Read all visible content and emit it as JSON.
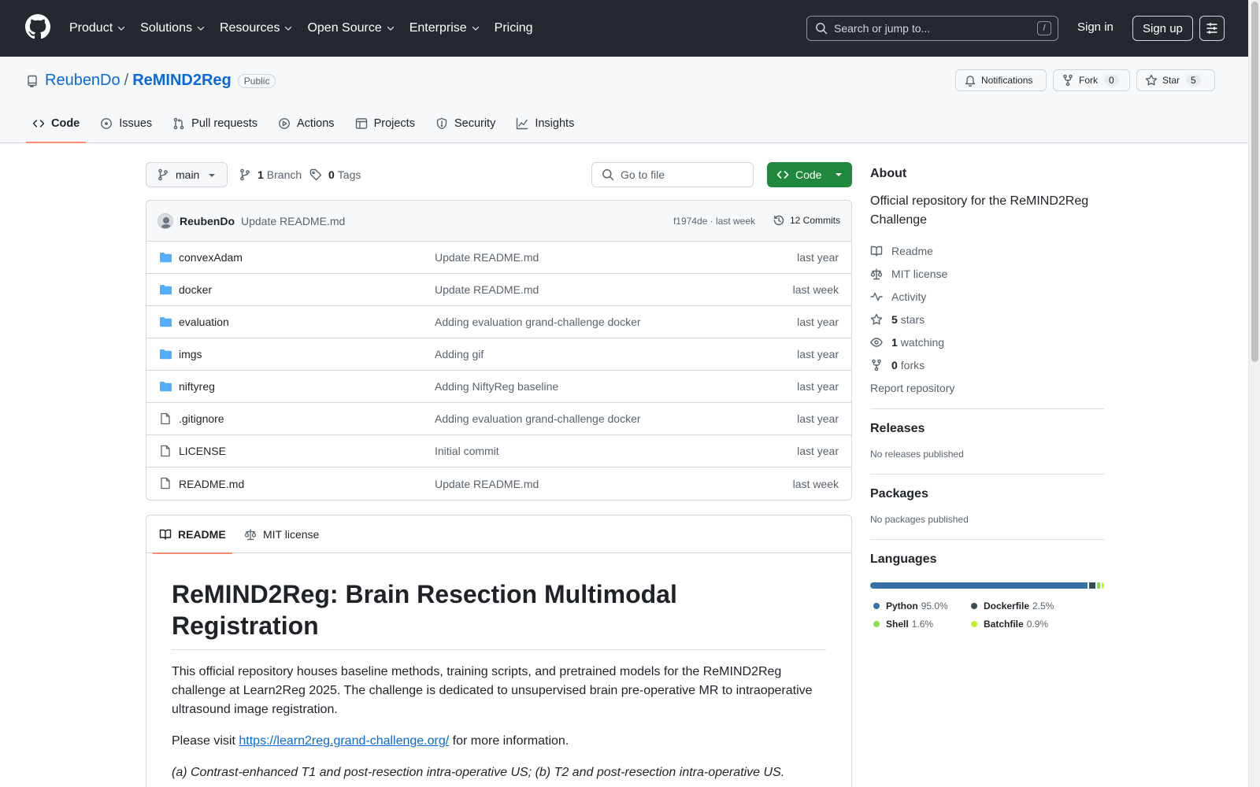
{
  "topnav": {
    "items": [
      {
        "label": "Product",
        "dropdown": true
      },
      {
        "label": "Solutions",
        "dropdown": true
      },
      {
        "label": "Resources",
        "dropdown": true
      },
      {
        "label": "Open Source",
        "dropdown": true
      },
      {
        "label": "Enterprise",
        "dropdown": true
      },
      {
        "label": "Pricing",
        "dropdown": false
      }
    ],
    "search_placeholder": "Search or jump to...",
    "search_shortcut": "/",
    "signin": "Sign in",
    "signup": "Sign up"
  },
  "repo": {
    "owner": "ReubenDo",
    "separator": "/",
    "name": "ReMIND2Reg",
    "visibility": "Public",
    "notifications_label": "Notifications",
    "fork_label": "Fork",
    "fork_count": "0",
    "star_label": "Star",
    "star_count": "5"
  },
  "tabs": [
    {
      "label": "Code",
      "icon": "code-icon",
      "active": true
    },
    {
      "label": "Issues",
      "icon": "issue-icon",
      "active": false
    },
    {
      "label": "Pull requests",
      "icon": "pull-request-icon",
      "active": false
    },
    {
      "label": "Actions",
      "icon": "play-icon",
      "active": false
    },
    {
      "label": "Projects",
      "icon": "table-icon",
      "active": false
    },
    {
      "label": "Security",
      "icon": "shield-icon",
      "active": false
    },
    {
      "label": "Insights",
      "icon": "graph-icon",
      "active": false
    }
  ],
  "toolbar": {
    "branch": "main",
    "branch_count": "1",
    "branch_label": "Branch",
    "tag_count": "0",
    "tag_label": "Tags",
    "gofile_placeholder": "Go to file",
    "code_label": "Code"
  },
  "commit": {
    "author": "ReubenDo",
    "message": "Update README.md",
    "meta": "f1974de · last week",
    "commits_label": "12 Commits"
  },
  "files": [
    {
      "name": "convexAdam",
      "type": "folder",
      "message": "Update README.md",
      "date": "last year"
    },
    {
      "name": "docker",
      "type": "folder",
      "message": "Update README.md",
      "date": "last week"
    },
    {
      "name": "evaluation",
      "type": "folder",
      "message": "Adding evaluation grand-challenge docker",
      "date": "last year"
    },
    {
      "name": "imgs",
      "type": "folder",
      "message": "Adding gif",
      "date": "last year"
    },
    {
      "name": "niftyreg",
      "type": "folder",
      "message": "Adding NiftyReg baseline",
      "date": "last year"
    },
    {
      "name": ".gitignore",
      "type": "file",
      "message": "Adding evaluation grand-challenge docker",
      "date": "last year"
    },
    {
      "name": "LICENSE",
      "type": "file",
      "message": "Initial commit",
      "date": "last year"
    },
    {
      "name": "README.md",
      "type": "file",
      "message": "Update README.md",
      "date": "last week"
    }
  ],
  "readme": {
    "tab_readme": "README",
    "tab_license": "MIT license",
    "title": "ReMIND2Reg: Brain Resection Multimodal Registration",
    "paragraph1": "This official repository houses baseline methods, training scripts, and pretrained models for the ReMIND2Reg challenge at Learn2Reg 2025. The challenge is dedicated to unsupervised brain pre-operative MR to intraoperative ultrasound image registration.",
    "visit_prefix": "Please visit ",
    "visit_link": "https://learn2reg.grand-challenge.org/",
    "visit_suffix": " for more information.",
    "caption": "(a) Contrast-enhanced T1 and post-resection intra-operative US; (b) T2 and post-resection intra-operative US."
  },
  "about": {
    "heading": "About",
    "description": "Official repository for the ReMIND2Reg Challenge",
    "links": [
      {
        "icon": "book-icon",
        "count": "",
        "label": "Readme"
      },
      {
        "icon": "law-icon",
        "count": "",
        "label": "MIT license"
      },
      {
        "icon": "pulse-icon",
        "count": "",
        "label": "Activity"
      },
      {
        "icon": "star-icon",
        "count": "5",
        "label": "stars"
      },
      {
        "icon": "eye-icon",
        "count": "1",
        "label": "watching"
      },
      {
        "icon": "fork-icon",
        "count": "0",
        "label": "forks"
      }
    ],
    "report": "Report repository"
  },
  "releases": {
    "heading": "Releases",
    "text": "No releases published"
  },
  "packages": {
    "heading": "Packages",
    "text": "No packages published"
  },
  "languages": {
    "heading": "Languages",
    "items": [
      {
        "name": "Python",
        "percent": "95.0%",
        "value": 95.0,
        "color": "#3572A5"
      },
      {
        "name": "Dockerfile",
        "percent": "2.5%",
        "value": 2.5,
        "color": "#384d54"
      },
      {
        "name": "Shell",
        "percent": "1.6%",
        "value": 1.6,
        "color": "#89e051"
      },
      {
        "name": "Batchfile",
        "percent": "0.9%",
        "value": 0.9,
        "color": "#C1F12E"
      }
    ]
  }
}
